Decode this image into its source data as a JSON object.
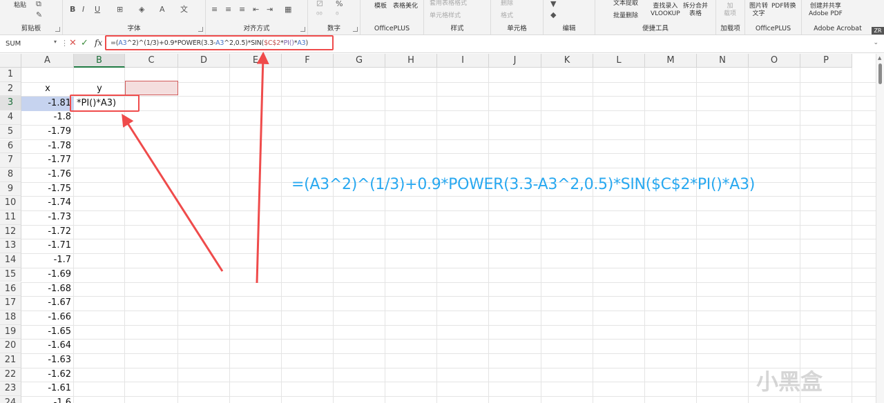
{
  "ribbon": {
    "groups": [
      {
        "label": "剪贴板"
      },
      {
        "label": "字体"
      },
      {
        "label": "对齐方式"
      },
      {
        "label": "数字"
      },
      {
        "label": "OfficePLUS"
      },
      {
        "label": "样式"
      },
      {
        "label": "单元格"
      },
      {
        "label": "编辑"
      },
      {
        "label": "便捷工具"
      },
      {
        "label": "加载项"
      },
      {
        "label": "OfficePLUS"
      },
      {
        "label": "Adobe Acrobat"
      }
    ],
    "paste_label": "粘贴",
    "template_label": "模板",
    "table_beautify_label": "表格美化",
    "table_format_label": "套用表格格式",
    "cell_style_label": "单元格样式",
    "delete_label": "删除",
    "format_label": "格式",
    "text_extract_label": "文本提取",
    "batch_delete_label": "批量删除",
    "lookup_label_1": "查找录入",
    "lookup_label_2": "VLOOKUP",
    "split_label_1": "拆分合并",
    "split_label_2": "表格",
    "addin_label_1": "加",
    "addin_label_2": "载项",
    "img_label_1": "图片转",
    "img_label_2": "文字",
    "pdf_label": "PDF转换",
    "share_label_1": "创建并共享",
    "share_label_2": "Adobe PDF",
    "badge": "ZR"
  },
  "formula_bar": {
    "name_box": "SUM",
    "cancel_icon": "✕",
    "enter_icon": "✓",
    "fx_label": "fx",
    "formula_parts": [
      "=(",
      "A3",
      "^2)^(1/3)+0.9*POWER(3.3-",
      "A3",
      "^2,0.5)*SIN(",
      "$C$2",
      "*",
      "PI()",
      "*",
      "A3",
      ")"
    ]
  },
  "grid": {
    "columns": [
      "A",
      "B",
      "C",
      "D",
      "E",
      "F",
      "G",
      "H",
      "I",
      "J",
      "K",
      "L",
      "M",
      "N",
      "O",
      "P"
    ],
    "rows": [
      "1",
      "2",
      "3",
      "4",
      "5",
      "6",
      "7",
      "8",
      "9",
      "10",
      "11",
      "12",
      "13",
      "14",
      "15",
      "16",
      "17",
      "18",
      "19",
      "20",
      "21",
      "22",
      "23",
      "24"
    ],
    "header_x": "x",
    "header_y": "y",
    "b3_editing": "*PI()*A3)",
    "column_a_values": [
      "-1.81",
      "-1.8",
      "-1.79",
      "-1.78",
      "-1.77",
      "-1.76",
      "-1.75",
      "-1.74",
      "-1.73",
      "-1.72",
      "-1.71",
      "-1.7",
      "-1.69",
      "-1.68",
      "-1.67",
      "-1.66",
      "-1.65",
      "-1.64",
      "-1.63",
      "-1.62",
      "-1.61",
      "-1.6"
    ]
  },
  "annotation": {
    "formula_text": "=(A3^2)^(1/3)+0.9*POWER(3.3-A3^2,0.5)*SIN($C$2*PI()*A3)",
    "arrow_color": "#ef4b4b",
    "text_color": "#28a8f0"
  },
  "watermark": "小黑盒"
}
